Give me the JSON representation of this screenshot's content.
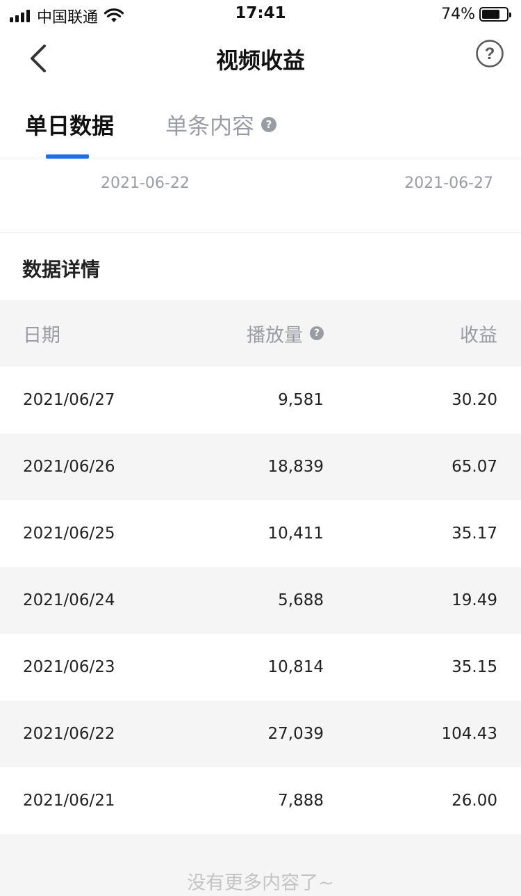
{
  "status_bar": {
    "carrier": "中国联通",
    "time": "17:41",
    "battery_pct": "74%",
    "battery_level": 0.74
  },
  "nav": {
    "title": "视频收益",
    "back_icon": "chevron-left-icon",
    "help_icon": "question-circle-icon"
  },
  "tabs": [
    {
      "label": "单日数据",
      "active": true
    },
    {
      "label": "单条内容",
      "active": false,
      "info_icon": "?"
    }
  ],
  "date_range": {
    "start": "2021-06-22",
    "end": "2021-06-27"
  },
  "section": {
    "title": "数据详情"
  },
  "table": {
    "headers": {
      "date": "日期",
      "views": "播放量",
      "views_info": "?",
      "income": "收益"
    },
    "rows": [
      {
        "date": "2021/06/27",
        "views": "9,581",
        "income": "30.20"
      },
      {
        "date": "2021/06/26",
        "views": "18,839",
        "income": "65.07"
      },
      {
        "date": "2021/06/25",
        "views": "10,411",
        "income": "35.17"
      },
      {
        "date": "2021/06/24",
        "views": "5,688",
        "income": "19.49"
      },
      {
        "date": "2021/06/23",
        "views": "10,814",
        "income": "35.15"
      },
      {
        "date": "2021/06/22",
        "views": "27,039",
        "income": "104.43"
      },
      {
        "date": "2021/06/21",
        "views": "7,888",
        "income": "26.00"
      }
    ]
  },
  "footer": {
    "text": "没有更多内容了~"
  },
  "colors": {
    "accent": "#1f6fe8",
    "muted_text": "#9a9ca3",
    "stripe": "#f5f5f5"
  }
}
